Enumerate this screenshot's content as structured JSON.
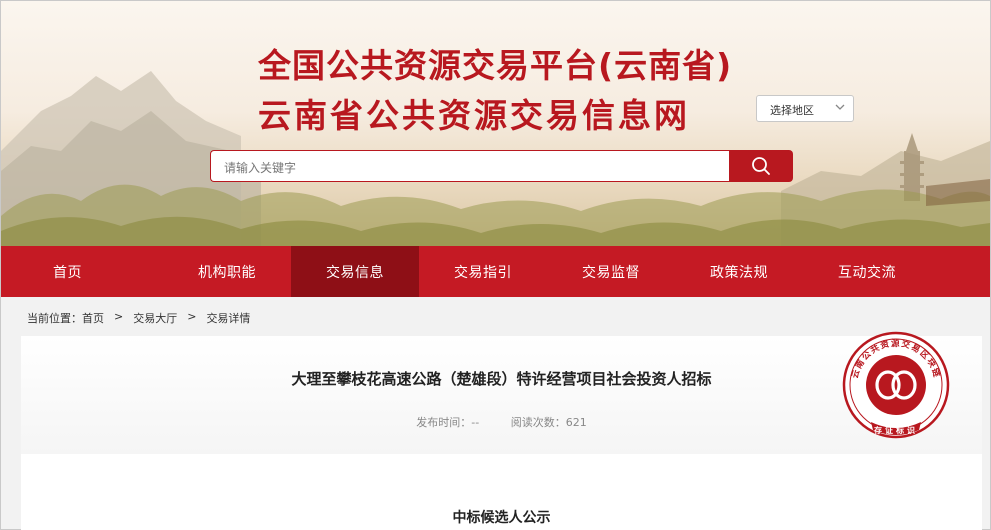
{
  "header": {
    "title_line1": "全国公共资源交易平台(云南省)",
    "title_line2": "云南省公共资源交易信息网",
    "region_select": "选择地区",
    "search_placeholder": "请输入关键字"
  },
  "nav": {
    "items": [
      {
        "label": "首页",
        "active": false
      },
      {
        "label": "机构职能",
        "active": false
      },
      {
        "label": "交易信息",
        "active": true
      },
      {
        "label": "交易指引",
        "active": false
      },
      {
        "label": "交易监督",
        "active": false
      },
      {
        "label": "政策法规",
        "active": false
      },
      {
        "label": "互动交流",
        "active": false
      }
    ]
  },
  "breadcrumb": {
    "prefix": "当前位置：",
    "items": [
      "首页",
      "交易大厅",
      "交易详情"
    ],
    "separator": ">"
  },
  "document": {
    "title": "大理至攀枝花高速公路（楚雄段）特许经营项目社会投资人招标",
    "publish_label": "发布时间：--",
    "views_label": "阅读次数：621",
    "section_title": "中标候选人公示"
  },
  "seal": {
    "ring_text": "云南公共资源交易区块链",
    "bottom_text": "存证标识",
    "icon": "chain-link-icon"
  },
  "colors": {
    "brand_red": "#c51a24",
    "active_red": "#8e0f16",
    "title_red": "#b8181f"
  }
}
